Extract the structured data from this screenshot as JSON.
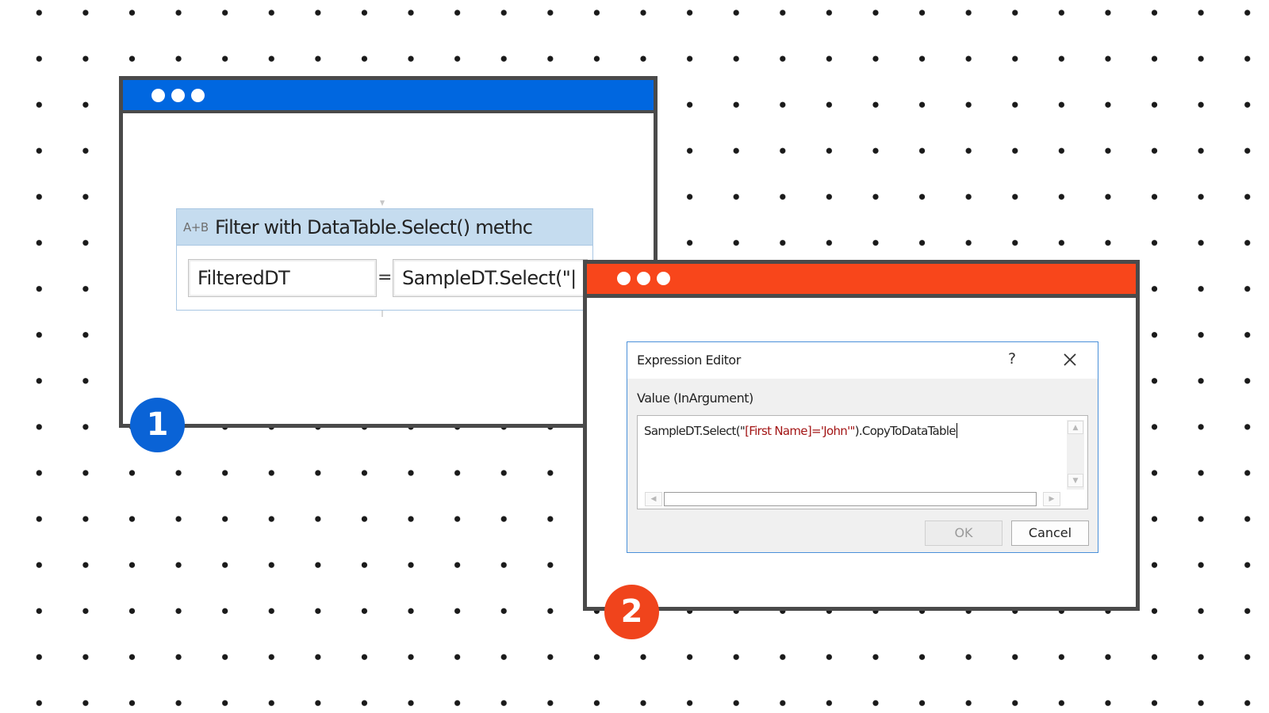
{
  "window1": {
    "badge": "1",
    "titlebar_color": "#0067e0",
    "activity": {
      "icon": "A+B",
      "title": "Filter with DataTable.Select() methc",
      "to_value": "FilteredDT",
      "equals": "=",
      "value": "SampleDT.Select(\"|"
    }
  },
  "window2": {
    "badge": "2",
    "titlebar_color": "#f8461b",
    "dialog": {
      "title": "Expression Editor",
      "help_label": "?",
      "label": "Value (InArgument)",
      "expression": {
        "prefix": "SampleDT.Select(\"",
        "string_literal": "[First Name]='John'\"",
        "suffix": ").CopyToDataTable"
      },
      "ok_label": "OK",
      "cancel_label": "Cancel"
    }
  },
  "icons": [
    "close-icon",
    "window-dots-icon",
    "scroll-arrow-icon"
  ]
}
